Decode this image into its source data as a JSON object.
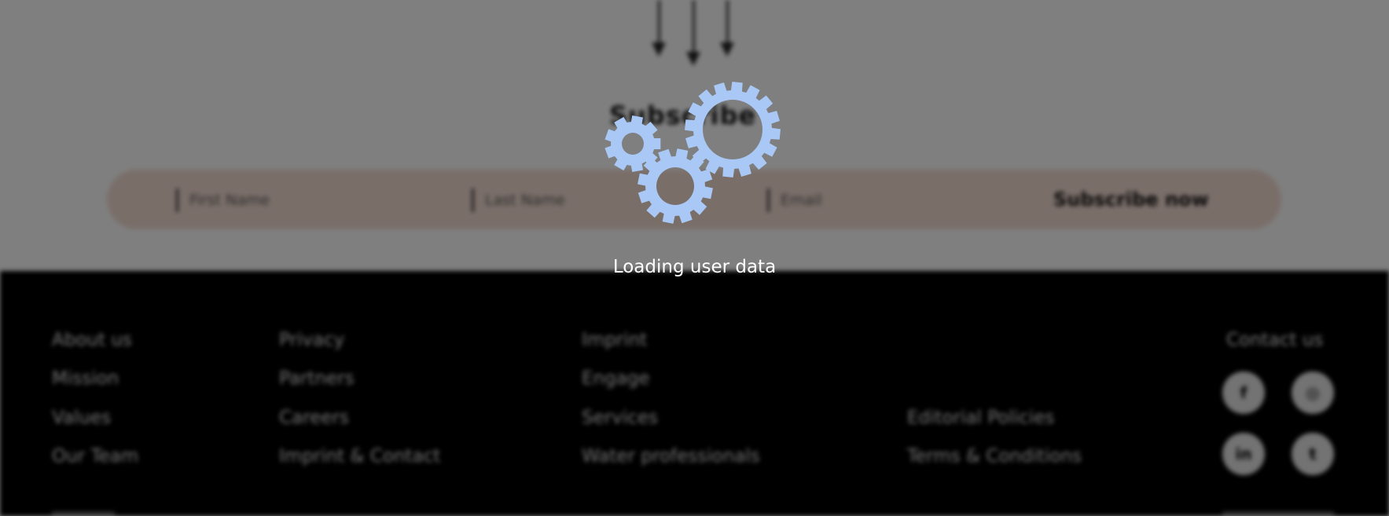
{
  "subscribe": {
    "title": "Subscribe",
    "first_name_placeholder": "First Name",
    "last_name_placeholder": "Last Name",
    "email_placeholder": "Email",
    "button_label": "Subscribe now"
  },
  "footer": {
    "col1": [
      "About us",
      "Mission",
      "Values",
      "Our Team"
    ],
    "col2": [
      "Privacy",
      "Partners",
      "Careers",
      "Imprint & Contact"
    ],
    "col3": [
      "Imprint",
      "Engage",
      "Services",
      "Water professionals"
    ],
    "col4": [
      "Editorial Policies",
      "Terms & Conditions"
    ],
    "contact_label": "Contact us",
    "social": [
      {
        "icon": "facebook-icon",
        "glyph": "f"
      },
      {
        "icon": "instagram-icon",
        "glyph": "◎"
      },
      {
        "icon": "linkedin-icon",
        "glyph": "in"
      },
      {
        "icon": "twitter-icon",
        "glyph": "t"
      }
    ]
  },
  "loader": {
    "text": "Loading user data",
    "gear_color": "#a9c8f5"
  },
  "colors": {
    "overlay": "#000000",
    "footer_bg": "#000000",
    "subscribe_bar": "#f4ddd3"
  }
}
